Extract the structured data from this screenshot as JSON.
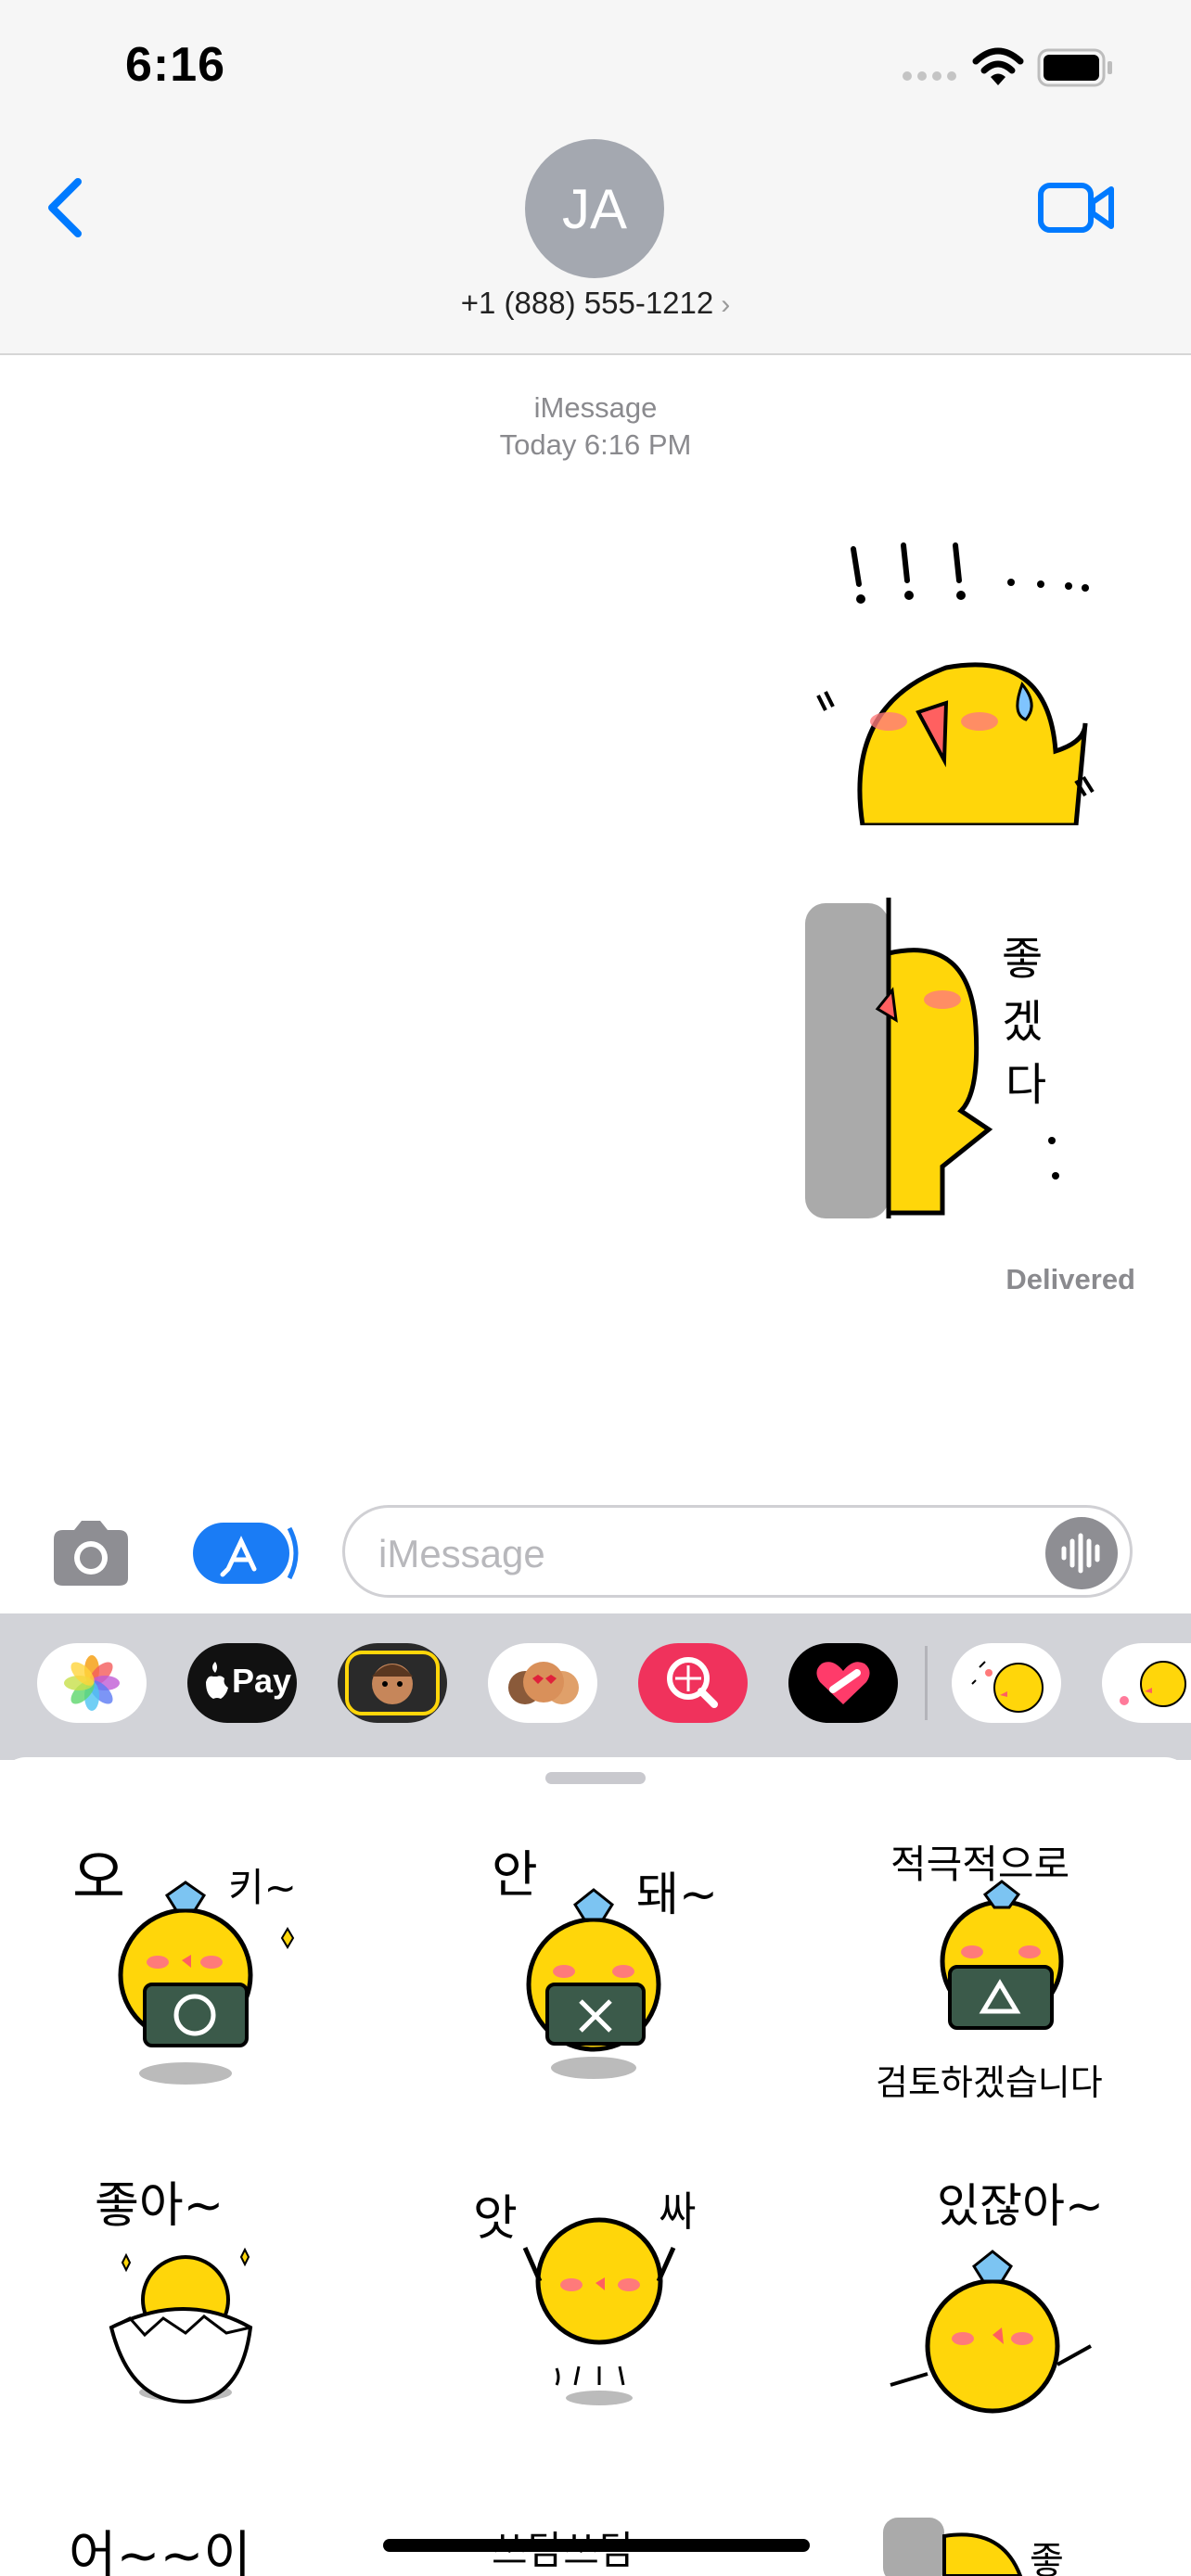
{
  "status_bar": {
    "time": "6:16"
  },
  "header": {
    "avatar_initials": "JA",
    "contact_number": "+1 (888) 555-1212",
    "contact_chevron": "›",
    "back_icon": "chevron-left-icon",
    "video_icon": "video-camera-icon"
  },
  "conversation": {
    "service": "iMessage",
    "timestamp": "Today 6:16 PM",
    "messages": [
      {
        "type": "sticker",
        "text": "!!!...",
        "from": "me"
      },
      {
        "type": "sticker",
        "text": "좋겠다..",
        "from": "me"
      }
    ],
    "status": "Delivered"
  },
  "composer": {
    "placeholder": "iMessage",
    "camera_icon": "camera-icon",
    "appstore_icon": "app-store-icon",
    "audio_icon": "waveform-icon"
  },
  "app_drawer": {
    "apps": [
      {
        "name": "Photos",
        "icon": "photos-icon"
      },
      {
        "name": "Apple Pay",
        "label": "Pay",
        "icon": "apple-pay-icon"
      },
      {
        "name": "Memoji",
        "icon": "memoji-icon"
      },
      {
        "name": "Memoji Stickers",
        "icon": "memoji-stickers-icon"
      },
      {
        "name": "Images",
        "icon": "image-search-icon"
      },
      {
        "name": "Digital Touch",
        "icon": "digital-touch-icon"
      },
      {
        "name": "Sticker Pack 1",
        "icon": "chick-sticker-icon"
      },
      {
        "name": "Sticker Pack 2",
        "icon": "chick-sticker-icon"
      }
    ]
  },
  "sticker_panel": {
    "stickers": [
      {
        "top": "오",
        "side": "키~"
      },
      {
        "top": "안",
        "side": "돼~"
      },
      {
        "top": "적극적으로",
        "bottom": "검토하겠습니다"
      },
      {
        "top": "좋아~"
      },
      {
        "top": "앗",
        "side": "싸"
      },
      {
        "top": "있잖아~"
      },
      {
        "top": "어~~이"
      },
      {
        "top": "쓰담쓰담"
      },
      {
        "top": "좋"
      }
    ]
  },
  "colors": {
    "accent": "#007aff",
    "chick": "#ffd60a",
    "blush": "#ff6b6b",
    "chalkboard": "#3b5a4a"
  }
}
